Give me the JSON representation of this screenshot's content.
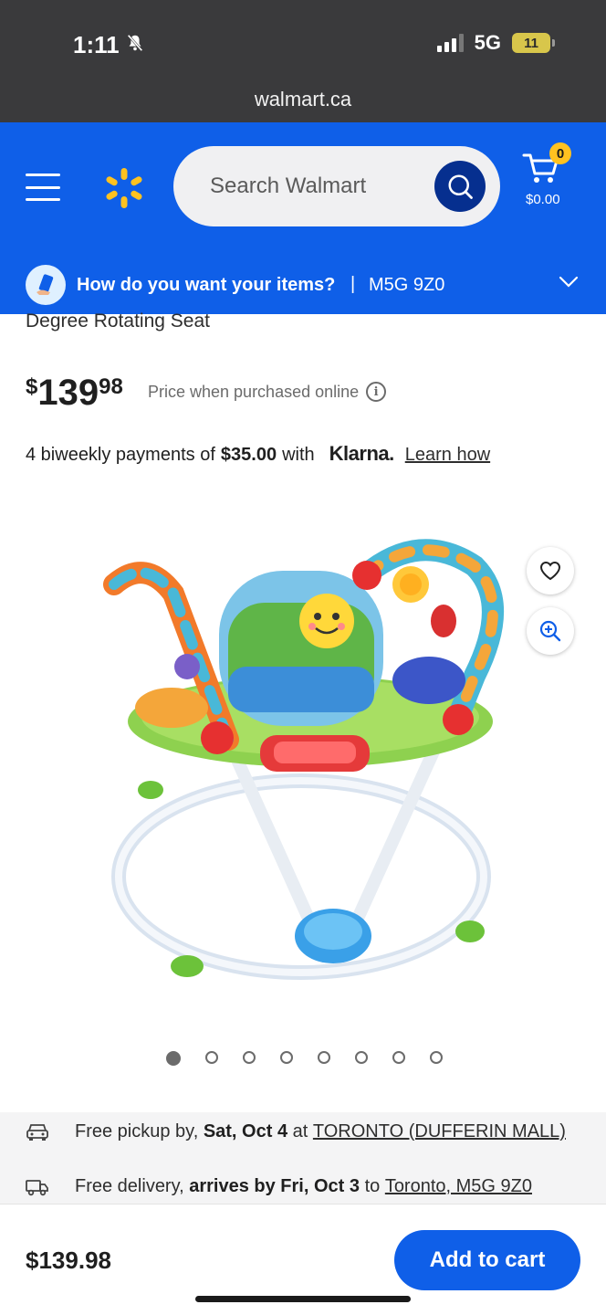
{
  "status_bar": {
    "time": "1:11",
    "network": "5G",
    "battery": "11"
  },
  "browser": {
    "url": "walmart.ca"
  },
  "header": {
    "search_placeholder": "Search Walmart",
    "cart_count": "0",
    "cart_total": "$0.00",
    "brand_color": "#0f5fe8",
    "spark_color": "#ffc220"
  },
  "delivery_bar": {
    "question": "How do you want your items?",
    "separator": "|",
    "postal_code": "M5G 9Z0"
  },
  "product": {
    "title_fragment": "Degree Rotating Seat",
    "price": {
      "currency": "$",
      "whole": "139",
      "cents": "98"
    },
    "price_note": "Price when purchased online",
    "klarna": {
      "prefix": "4 biweekly payments of",
      "amount": "$35.00",
      "with": "with",
      "brand": "Klarna.",
      "link": "Learn how"
    },
    "image_count": 8,
    "active_image": 1
  },
  "fulfillment": {
    "pickup": {
      "prefix": "Free pickup by,",
      "date": "Sat, Oct 4",
      "at": "at",
      "store": "TORONTO (DUFFERIN MALL)"
    },
    "delivery": {
      "prefix": "Free delivery,",
      "arrives": "arrives by Fri, Oct 3",
      "to": "to",
      "location": "Toronto, M5G 9Z0"
    }
  },
  "bottom_bar": {
    "price": "$139.98",
    "add_to_cart": "Add to cart"
  }
}
